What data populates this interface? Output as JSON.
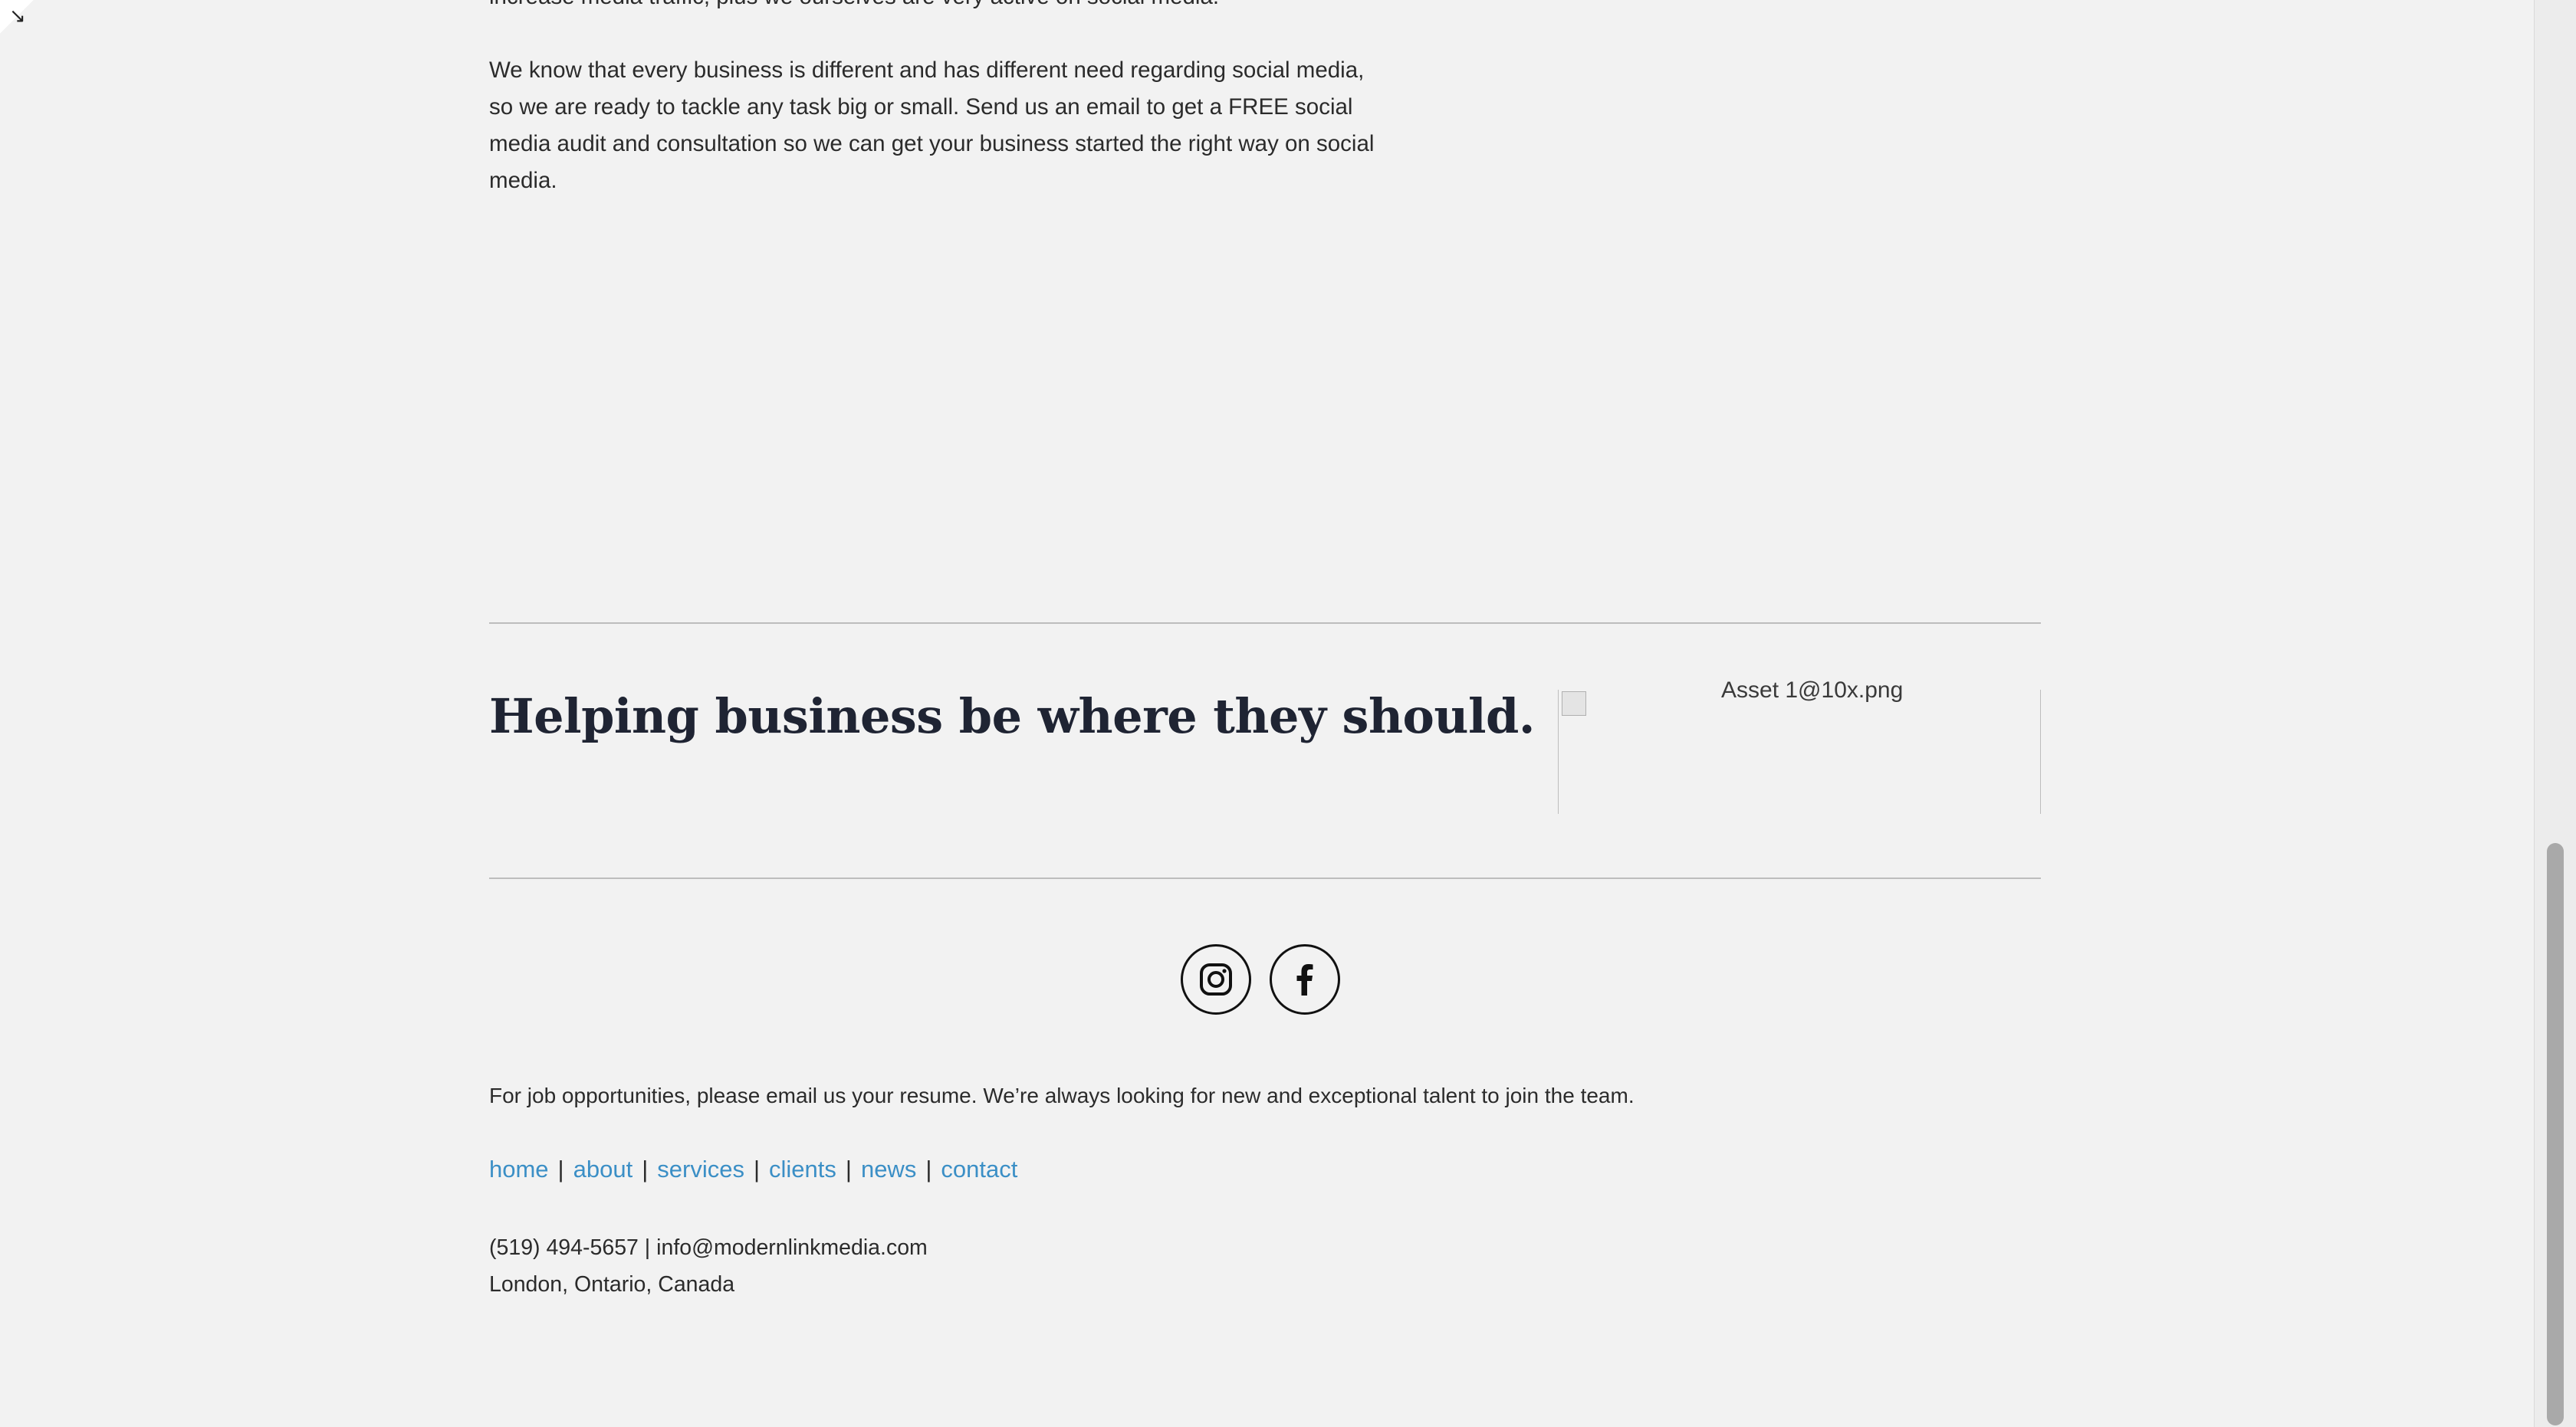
{
  "intro": {
    "cut_line": "increase media traffic, plus we ourselves are very active on social media.",
    "paragraph": "We know that every business is different and has different need regarding social media, so we are ready to tackle any task big or small. Send us an email to get a FREE social media audit and consultation so we can get your business started the right way on social media."
  },
  "footer": {
    "tagline": "Helping business be where they should.",
    "logo_alt": "Asset 1@10x.png",
    "social": [
      {
        "name": "instagram-icon"
      },
      {
        "name": "facebook-icon"
      }
    ],
    "jobs_text": "For job opportunities, please email us your resume. We’re always looking for new and exceptional talent to join the team.",
    "nav": {
      "items": [
        "home",
        "about",
        "services",
        "clients",
        "news",
        "contact"
      ],
      "separator": "|"
    },
    "contact": {
      "phone_email": "(519) 494-5657 | info@modernlinkmedia.com",
      "address": "London, Ontario, Canada"
    }
  },
  "colors": {
    "background": "#f2f2f2",
    "link": "#3b8fc6",
    "text": "#2b2b2b",
    "heading": "#1f2433"
  }
}
